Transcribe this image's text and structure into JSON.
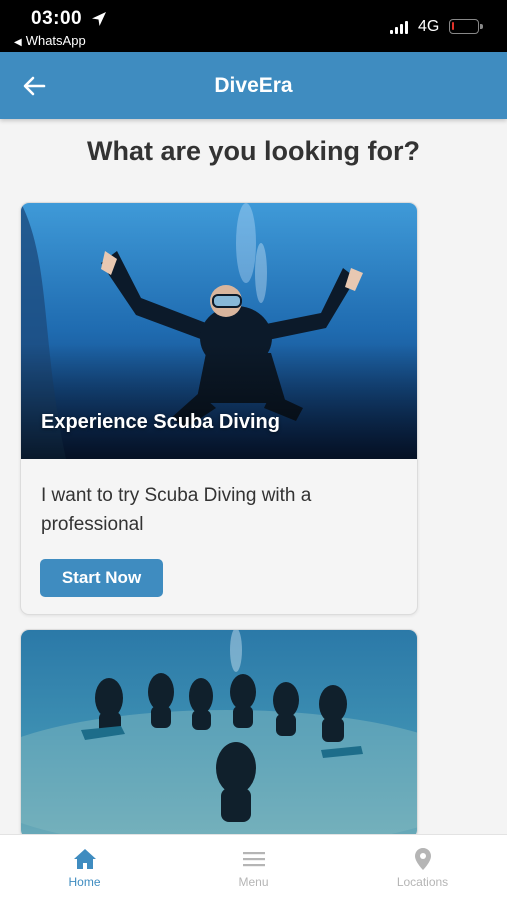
{
  "status_bar": {
    "time": "03:00",
    "back_app": "WhatsApp",
    "network": "4G",
    "battery_level": 0.1,
    "battery_color": "#e0322a"
  },
  "header": {
    "title": "DiveEra",
    "back_icon": "arrow-left-icon",
    "background": "#3f8cc0"
  },
  "main": {
    "heading": "What are you looking for?",
    "cards": [
      {
        "image_title": "Experience Scuba Diving",
        "description": "I want to try Scuba Diving with a professional",
        "button_label": "Start Now"
      },
      {
        "image_title": "",
        "description": "",
        "button_label": ""
      }
    ]
  },
  "bottom_nav": {
    "items": [
      {
        "label": "Home",
        "icon": "home-icon",
        "active": true
      },
      {
        "label": "Menu",
        "icon": "menu-icon",
        "active": false
      },
      {
        "label": "Locations",
        "icon": "location-pin-icon",
        "active": false
      }
    ],
    "active_color": "#3f8cc0",
    "inactive_color": "#b5b5b5"
  }
}
